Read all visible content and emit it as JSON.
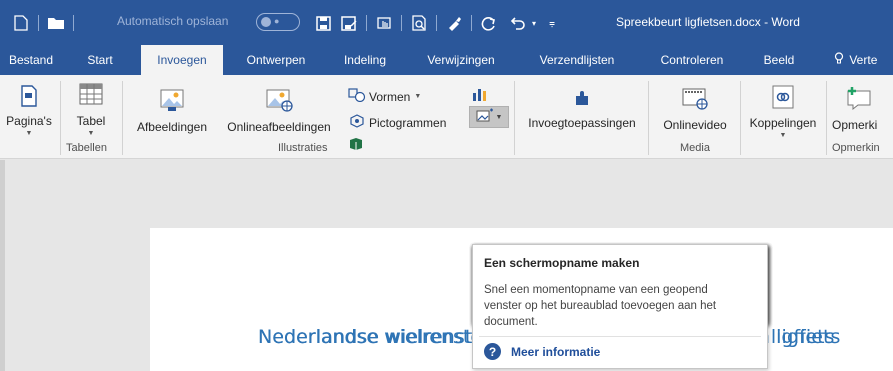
{
  "titlebar": {
    "autosave_label": "Automatisch opslaan",
    "autosave_state": "●",
    "document_title": "Spreekbeurt ligfietsen.docx - Word",
    "background": "#2b579a"
  },
  "tabs": [
    {
      "label": "Bestand"
    },
    {
      "label": "Start"
    },
    {
      "label": "Invoegen"
    },
    {
      "label": "Ontwerpen"
    },
    {
      "label": "Indeling"
    },
    {
      "label": "Verwijzingen"
    },
    {
      "label": "Verzendlijsten"
    },
    {
      "label": "Controleren"
    },
    {
      "label": "Beeld"
    },
    {
      "label": "Verte"
    }
  ],
  "ribbon": {
    "pagina": "Pagina's",
    "tabel": "Tabel",
    "afbeeldingen": "Afbeeldingen",
    "onlineafbeeldingen": "Onlineafbeeldingen",
    "vormen": "Vormen",
    "pictogrammen": "Pictogrammen",
    "invoegtoepassingen": "Invoegtoepassingen",
    "onlinevideo": "Onlinevideo",
    "koppelingen": "Koppelingen",
    "opmerking": "Opmerki",
    "groups": {
      "tabellen": "Tabellen",
      "illustraties": "Illustraties",
      "media": "Media",
      "opmerkingen": "Opmerkin"
    }
  },
  "tooltip": {
    "title": "Een schermopname maken",
    "body": "Snel een momentopname van een geopend venster op het bureaublad toevoegen aan het document.",
    "link": "Meer informatie"
  },
  "document": {
    "heading": "Nederlandse wielrenster verbetert snelheidsrecord in ligfiets",
    "heading_color": "#2e74b5"
  }
}
